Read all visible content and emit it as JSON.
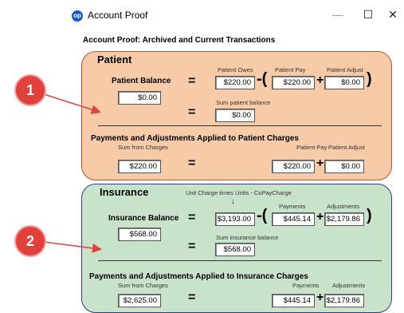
{
  "window": {
    "title": "Account Proof",
    "app_icon_text": "op",
    "minimize": "—",
    "maximize": "☐",
    "close": "✕"
  },
  "heading": "Account Proof:  Archived and Current Transactions",
  "patient": {
    "title": "Patient",
    "balance_label": "Patient Balance",
    "balance_value": "$0.00",
    "col_owes": "Patient Owes",
    "col_pay": "Patient Pay",
    "col_adjust": "Patient Adjust",
    "owes_value": "$220.00",
    "pay_value": "$220.00",
    "adjust_value": "$0.00",
    "sum_label": "Sum patient balance",
    "sum_value": "$0.00",
    "section2_label": "Payments and Adjustments Applied to Patient Charges",
    "sum_charges_label": "Sum from Charges",
    "sum_charges_value": "$220.00",
    "pay2_label": "Patient Pay",
    "adjust2_label": "Patient Adjust",
    "pay2_value": "$220.00",
    "adjust2_value": "$0.00"
  },
  "insurance": {
    "title": "Insurance",
    "unit_charge_label": "Unit Charge times Units - CoPayCharge",
    "arrow_glyph": "↓",
    "balance_label": "Insurance Balance",
    "balance_value": "$568.00",
    "col_pay": "Payments",
    "col_adjust": "Adjustments",
    "charge_value": "$3,193.00",
    "pay_value": "$445.14",
    "adjust_value": "$2,179.86",
    "sum_label": "Sum insurance balance",
    "sum_value": "$568.00",
    "section2_label": "Payments and Adjustments Applied to Insurance Charges",
    "sum_charges_label": "Sum from Charges",
    "sum_charges_value": "$2,625.00",
    "pay2_label": "Payments",
    "adjust2_label": "Adjustments",
    "pay2_value": "$445.14",
    "adjust2_value": "$2,179.86"
  },
  "symbols": {
    "equals": "=",
    "minus": "-",
    "plus": "+",
    "open_paren": "(",
    "close_paren": ")"
  },
  "callouts": {
    "one": "1",
    "two": "2"
  },
  "colors": {
    "callout": "#e0413c",
    "patient_bg": "#f7cba7",
    "insurance_bg": "#c9e3cb"
  }
}
